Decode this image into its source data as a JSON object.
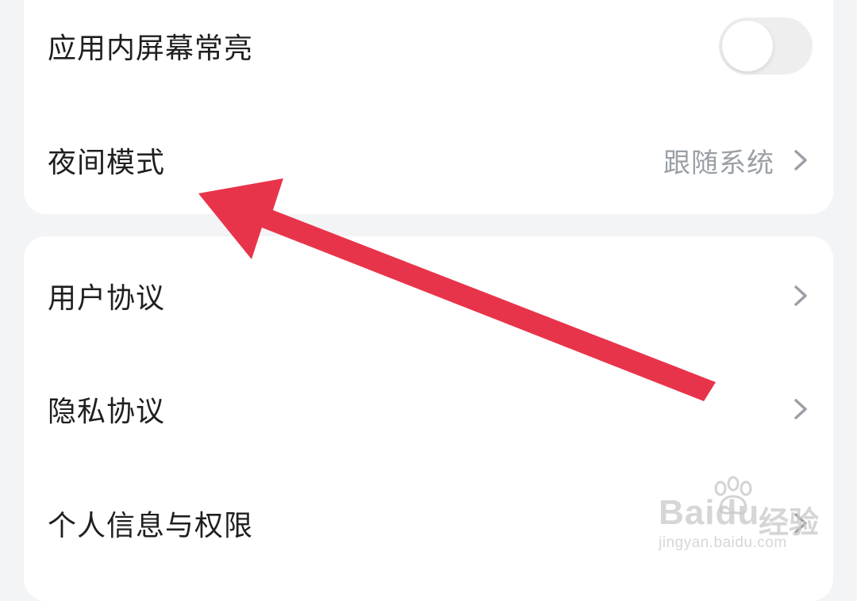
{
  "settings_group_1": {
    "keep_screen_on": {
      "label": "应用内屏幕常亮",
      "toggle_on": false
    },
    "night_mode": {
      "label": "夜间模式",
      "value": "跟随系统"
    }
  },
  "settings_group_2": {
    "items": [
      {
        "label": "用户协议"
      },
      {
        "label": "隐私协议"
      },
      {
        "label": "个人信息与权限"
      }
    ]
  },
  "annotation": {
    "arrow_color": "#e8344a"
  },
  "watermark": {
    "brand": "Bai",
    "brand_suffix": "du",
    "product": "经验",
    "url": "jingyan.baidu.com"
  },
  "colors": {
    "background": "#f3f4f6",
    "card": "#ffffff",
    "label_text": "#1f1f1f",
    "value_text": "#9aa0a6",
    "chevron": "#9aa0a6"
  }
}
